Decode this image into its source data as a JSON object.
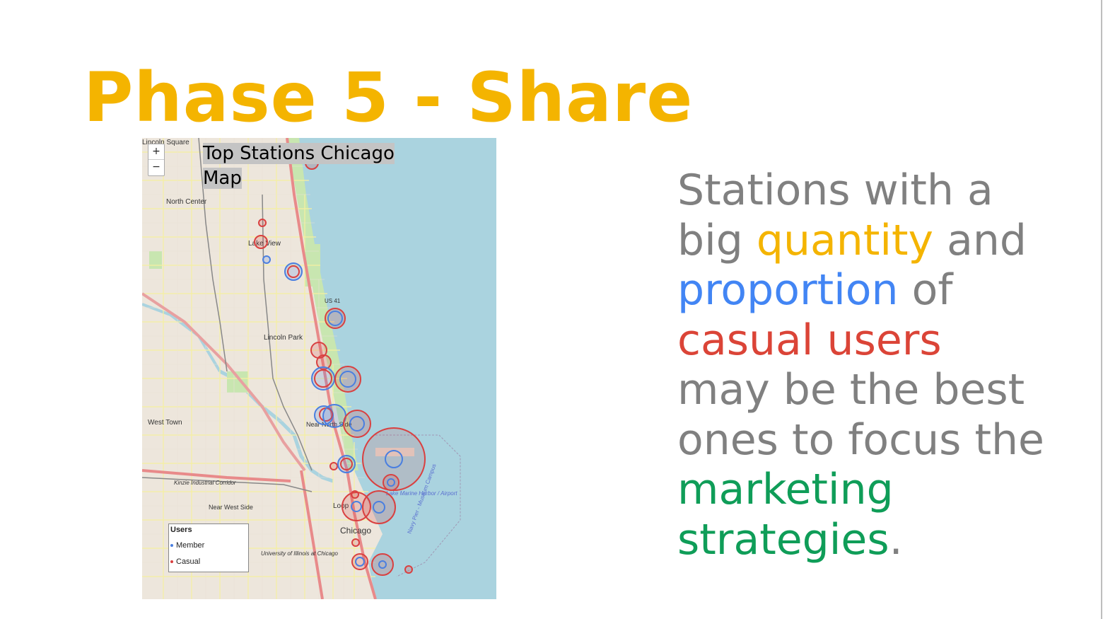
{
  "slide": {
    "title": "Phase 5 - Share"
  },
  "map": {
    "title": "Top Stations Chicago Map",
    "zoom_in_label": "+",
    "zoom_out_label": "−",
    "legend": {
      "title": "Users",
      "items": [
        {
          "label": "Member",
          "color": "#4a7fe0"
        },
        {
          "label": "Casual",
          "color": "#d94040"
        }
      ]
    },
    "place_labels": [
      "Lincoln Square",
      "North Center",
      "Lake View",
      "Lincoln Park",
      "US 41",
      "West Town",
      "Near North Side",
      "Kinzie Industrial Corridor",
      "Near West Side",
      "Loop",
      "Chicago",
      "University of Illinois at Chicago",
      "Navy Pier - Museum Campus",
      "Lake Marine Harbor / Airport"
    ],
    "colors": {
      "water": "#aad3df",
      "member": "#4a7fe0",
      "casual": "#d94040"
    }
  },
  "body": {
    "segments": [
      {
        "text": "Stations with a big ",
        "color": "#808080"
      },
      {
        "text": "quantity",
        "color": "#f4b400"
      },
      {
        "text": " and ",
        "color": "#808080"
      },
      {
        "text": "proportion",
        "color": "#4285f4"
      },
      {
        "text": " of ",
        "color": "#808080"
      },
      {
        "text": "casual users",
        "color": "#db4437"
      },
      {
        "text": " may be the best ones to focus the ",
        "color": "#808080"
      },
      {
        "text": "marketing strategies",
        "color": "#0f9d58"
      },
      {
        "text": ".",
        "color": "#808080"
      }
    ]
  }
}
